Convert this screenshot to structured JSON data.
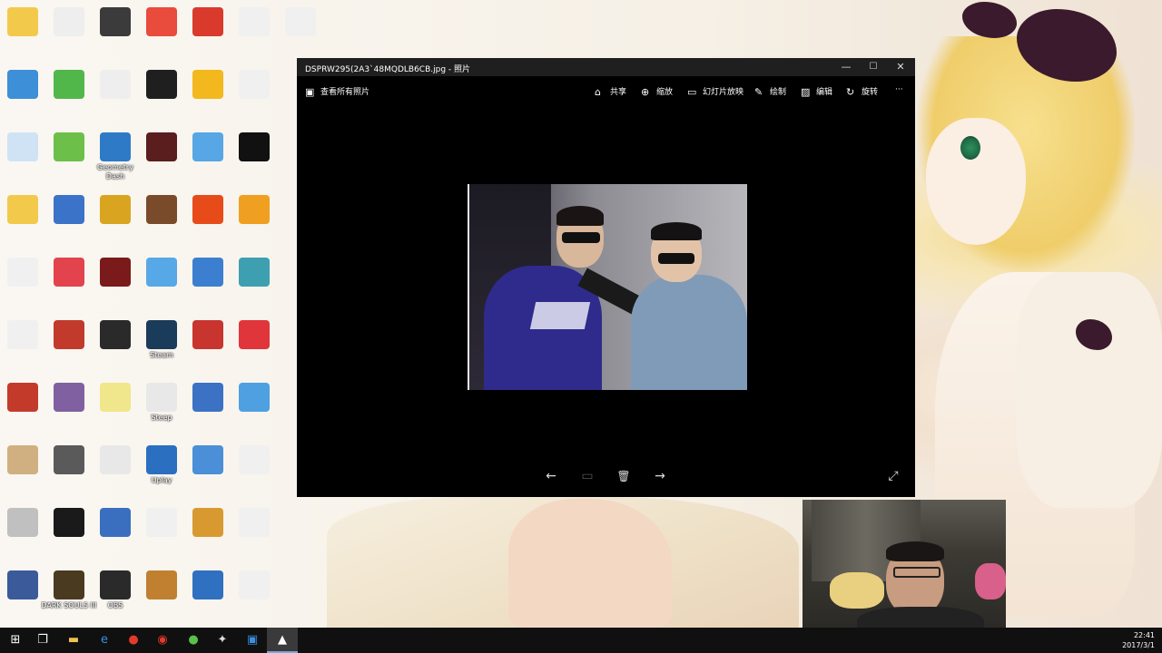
{
  "desktop": {
    "icons": [
      {
        "label": "",
        "color": "#f3c94b"
      },
      {
        "label": "",
        "color": "#eeeeee"
      },
      {
        "label": "",
        "color": "#3b3b3b"
      },
      {
        "label": "",
        "color": "#e94b3c"
      },
      {
        "label": "",
        "color": "#d93a2b"
      },
      {
        "label": "",
        "color": "#f0f0f0"
      },
      {
        "label": "",
        "color": "#f0f0f0"
      },
      {
        "label": "",
        "color": "#3d8fd8"
      },
      {
        "label": "",
        "color": "#51b74a"
      },
      {
        "label": "",
        "color": "#eeeeee"
      },
      {
        "label": "",
        "color": "#1f1f1f"
      },
      {
        "label": "",
        "color": "#f2b81d"
      },
      {
        "label": "",
        "color": "#f0f0f0"
      },
      {
        "label": "",
        "color": "#cfe3f5"
      },
      {
        "label": "",
        "color": "#6cc04a"
      },
      {
        "label": "Geometry Dash",
        "color": "#2f7ac7"
      },
      {
        "label": "",
        "color": "#5a1e1e"
      },
      {
        "label": "",
        "color": "#57a6e6"
      },
      {
        "label": "",
        "color": "#111111"
      },
      {
        "label": "",
        "color": "#f3c94b"
      },
      {
        "label": "",
        "color": "#3a73c8"
      },
      {
        "label": "",
        "color": "#d9a521"
      },
      {
        "label": "",
        "color": "#7a4b2a"
      },
      {
        "label": "",
        "color": "#e84b1a"
      },
      {
        "label": "",
        "color": "#f0a020"
      },
      {
        "label": "",
        "color": "#f0f0f0"
      },
      {
        "label": "",
        "color": "#e2434d"
      },
      {
        "label": "",
        "color": "#7a1a1a"
      },
      {
        "label": "",
        "color": "#57a8e6"
      },
      {
        "label": "",
        "color": "#3c7fd0"
      },
      {
        "label": "",
        "color": "#3e9fb0"
      },
      {
        "label": "",
        "color": "#f0f0f0"
      },
      {
        "label": "",
        "color": "#c23a2b"
      },
      {
        "label": "",
        "color": "#2a2a2a"
      },
      {
        "label": "Steam",
        "color": "#1b3b5a"
      },
      {
        "label": "",
        "color": "#c8352e"
      },
      {
        "label": "",
        "color": "#e0353a"
      },
      {
        "label": "",
        "color": "#c43a2a"
      },
      {
        "label": "",
        "color": "#8060a0"
      },
      {
        "label": "",
        "color": "#f0e68c"
      },
      {
        "label": "Steep",
        "color": "#e8e8e8"
      },
      {
        "label": "",
        "color": "#3b72c4"
      },
      {
        "label": "",
        "color": "#4fa0e0"
      },
      {
        "label": "",
        "color": "#d0b080"
      },
      {
        "label": "",
        "color": "#5a5a5a"
      },
      {
        "label": "",
        "color": "#e8e8e8"
      },
      {
        "label": "Uplay",
        "color": "#2b6fc0"
      },
      {
        "label": "",
        "color": "#4a8fd8"
      },
      {
        "label": "",
        "color": "#f0f0f0"
      },
      {
        "label": "",
        "color": "#c0c0c0"
      },
      {
        "label": "",
        "color": "#1a1a1a"
      },
      {
        "label": "",
        "color": "#3a6fc0"
      },
      {
        "label": "",
        "color": "#f0f0f0"
      },
      {
        "label": "",
        "color": "#d89a30"
      },
      {
        "label": "",
        "color": "#f0f0f0"
      },
      {
        "label": "",
        "color": "#3a5a9a"
      },
      {
        "label": "DARK SOULS III",
        "color": "#4a3a20"
      },
      {
        "label": "OBS",
        "color": "#2a2a2a"
      },
      {
        "label": "",
        "color": "#c08030"
      },
      {
        "label": "",
        "color": "#3070c0"
      },
      {
        "label": "",
        "color": "#f0f0f0"
      }
    ]
  },
  "photos_window": {
    "title": "DSPRW295(2A3`48MQDLB6CB.jpg - 照片",
    "view_all": "查看所有照片",
    "toolbar": {
      "share": "共享",
      "zoom": "缩放",
      "slideshow": "幻灯片放映",
      "draw": "绘制",
      "edit": "编辑",
      "rotate": "旋转",
      "more": "···"
    },
    "controls": {
      "minimize": "—",
      "maximize": "☐",
      "close": "✕"
    },
    "nav": {
      "prev": "←",
      "next": "→",
      "delete": "🗑",
      "fullscreen": "⤢"
    }
  },
  "taskbar": {
    "time": "22:41",
    "date": "2017/3/1"
  }
}
